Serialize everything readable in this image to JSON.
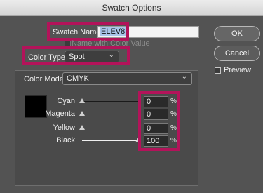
{
  "window": {
    "title": "Swatch Options"
  },
  "swatch_name": {
    "label": "Swatch Name:",
    "value": "ELEV8"
  },
  "name_with_color_value": {
    "label": "Name with Color Value"
  },
  "color_type": {
    "label": "Color Type:",
    "value": "Spot"
  },
  "color_mode": {
    "label": "Color Mode:",
    "value": "CMYK"
  },
  "buttons": {
    "ok": "OK",
    "cancel": "Cancel"
  },
  "preview": {
    "label": "Preview"
  },
  "channels": [
    {
      "label": "Cyan",
      "value": "0",
      "unit": "%",
      "level": 0
    },
    {
      "label": "Magenta",
      "value": "0",
      "unit": "%",
      "level": 0
    },
    {
      "label": "Yellow",
      "value": "0",
      "unit": "%",
      "level": 0
    },
    {
      "label": "Black",
      "value": "100",
      "unit": "%",
      "level": 1
    }
  ],
  "colors": {
    "highlight": "#b3135a",
    "swatch": "#000000",
    "dialog_bg": "#535353"
  }
}
